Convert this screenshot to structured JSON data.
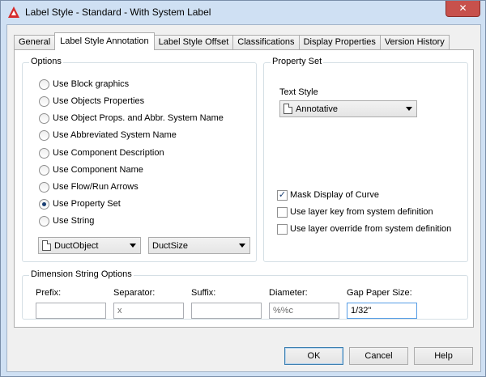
{
  "window": {
    "title": "Label Style - Standard - With System Label",
    "close_glyph": "✕"
  },
  "tabs": [
    {
      "label": "General",
      "active": false
    },
    {
      "label": "Label Style Annotation",
      "active": true
    },
    {
      "label": "Label Style Offset",
      "active": false
    },
    {
      "label": "Classifications",
      "active": false
    },
    {
      "label": "Display Properties",
      "active": false
    },
    {
      "label": "Version History",
      "active": false
    }
  ],
  "options": {
    "group_label": "Options",
    "radios": [
      {
        "label": "Use Block graphics",
        "checked": false
      },
      {
        "label": "Use Objects Properties",
        "checked": false
      },
      {
        "label": "Use Object Props. and Abbr. System Name",
        "checked": false
      },
      {
        "label": "Use Abbreviated System Name",
        "checked": false
      },
      {
        "label": "Use Component Description",
        "checked": false
      },
      {
        "label": "Use Component Name",
        "checked": false
      },
      {
        "label": "Use Flow/Run Arrows",
        "checked": false
      },
      {
        "label": "Use Property Set",
        "checked": true
      },
      {
        "label": "Use String",
        "checked": false
      }
    ],
    "object_combo": "DuctObject",
    "property_combo": "DuctSize"
  },
  "property_set": {
    "group_label": "Property Set",
    "text_style_label": "Text Style",
    "text_style_value": "Annotative",
    "checks": [
      {
        "label": "Mask Display of Curve",
        "checked": true
      },
      {
        "label": "Use layer key from system definition",
        "checked": false
      },
      {
        "label": "Use layer override from system definition",
        "checked": false
      }
    ],
    "check_glyph": "✓"
  },
  "dimension": {
    "group_label": "Dimension String Options",
    "fields": [
      {
        "label": "Prefix:",
        "value": "",
        "disabled": false
      },
      {
        "label": "Separator:",
        "value": "x",
        "disabled": true
      },
      {
        "label": "Suffix:",
        "value": "",
        "disabled": false
      },
      {
        "label": "Diameter:",
        "value": "%%c",
        "disabled": true
      },
      {
        "label": "Gap Paper Size:",
        "value": "1/32\"",
        "disabled": false
      }
    ]
  },
  "buttons": {
    "ok": "OK",
    "cancel": "Cancel",
    "help": "Help"
  },
  "colors": {
    "title_bar": "#cfe0f3",
    "close": "#c7514c",
    "accent": "#1a3f73"
  }
}
